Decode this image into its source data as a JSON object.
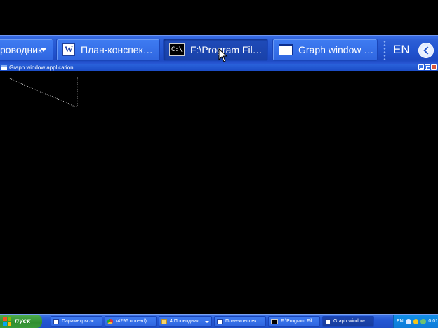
{
  "zoomed_taskbar": {
    "items": [
      {
        "label": "роводник",
        "icon": "folder-icon"
      },
      {
        "label": "План-конспек…",
        "icon": "word-icon"
      },
      {
        "label": "F:\\Program Fil…",
        "icon": "cmd-icon"
      },
      {
        "label": "Graph window …",
        "icon": "window-icon"
      }
    ],
    "cmd_icon_text": "C:\\",
    "language": "EN"
  },
  "window": {
    "title": "Graph window application"
  },
  "taskbar": {
    "start_label": "пуск",
    "items": [
      {
        "label": "Параметры эк…",
        "icon": "display-icon"
      },
      {
        "label": "(4296 unread)…",
        "icon": "chrome-icon"
      },
      {
        "label": "4 Проводник",
        "icon": "folder-icon"
      },
      {
        "label": "План-конспек…",
        "icon": "word-icon"
      },
      {
        "label": "F:\\Program Fil…",
        "icon": "cmd-icon"
      },
      {
        "label": "Graph window …",
        "icon": "window-icon"
      }
    ],
    "language": "EN",
    "clock": "0:01"
  },
  "colors": {
    "taskbar_blue": "#2458d4",
    "start_green": "#3a9a3a",
    "tray_blue": "#0d7ad8",
    "canvas": "#000000"
  }
}
